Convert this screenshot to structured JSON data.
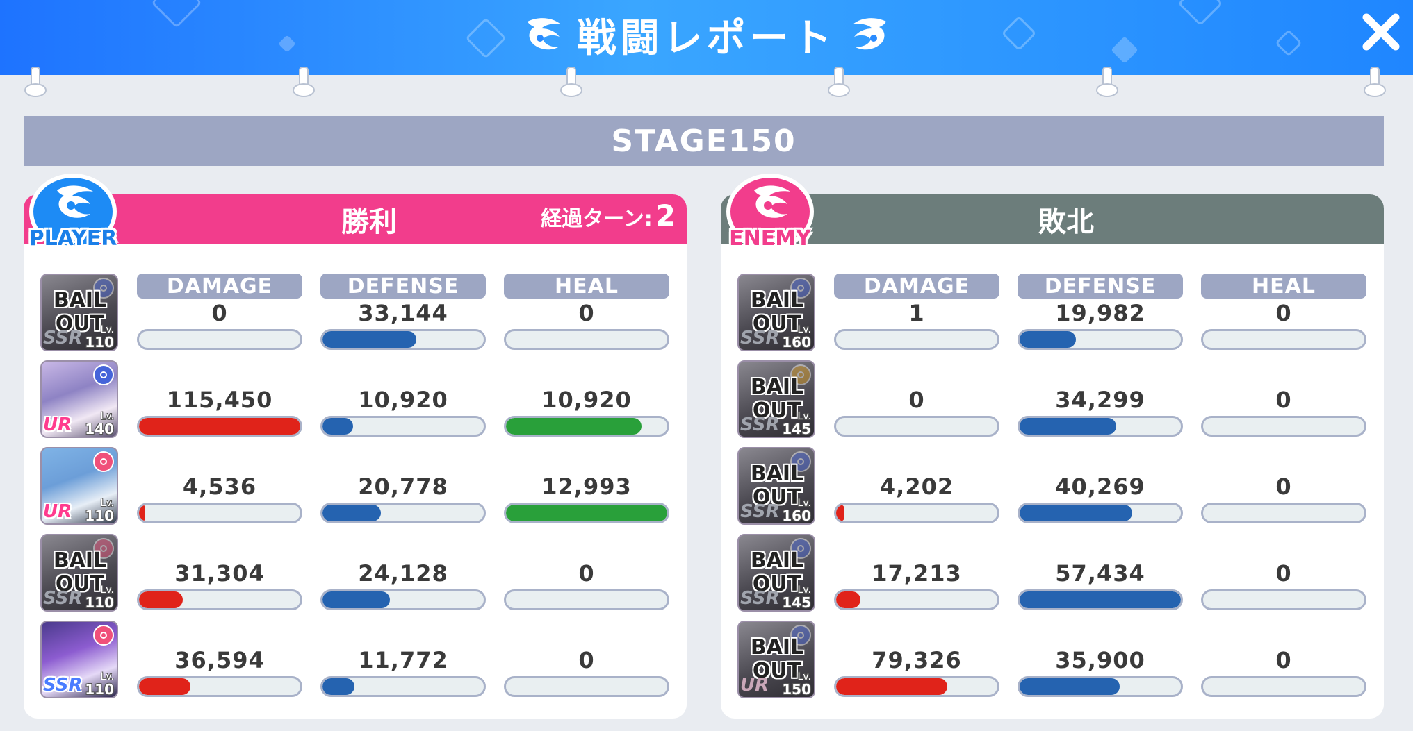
{
  "header": {
    "title": "戦闘レポート",
    "close_icon": "close-icon"
  },
  "stage": {
    "label": "STAGE150"
  },
  "columns": {
    "damage": "DAMAGE",
    "defense": "DEFENSE",
    "heal": "HEAL"
  },
  "player": {
    "badge": "PLAYER",
    "result": "勝利",
    "turns_label": "経過ターン:",
    "turns_value": "2",
    "units": [
      {
        "bail": true,
        "bail_line1": "BAIL",
        "bail_line2": "OUT",
        "rarity": "SSR",
        "lv_label": "Lv.",
        "level": "110",
        "damage": "0",
        "defense": "33,144",
        "heal": "0",
        "damage_ratio": 0,
        "defense_ratio": 0.58,
        "heal_ratio": 0
      },
      {
        "bail": false,
        "rarity": "UR",
        "lv_label": "Lv.",
        "level": "140",
        "damage": "115,450",
        "defense": "10,920",
        "heal": "10,920",
        "damage_ratio": 1.0,
        "defense_ratio": 0.19,
        "heal_ratio": 0.84
      },
      {
        "bail": false,
        "rarity": "UR",
        "lv_label": "Lv.",
        "level": "110",
        "damage": "4,536",
        "defense": "20,778",
        "heal": "12,993",
        "damage_ratio": 0.04,
        "defense_ratio": 0.36,
        "heal_ratio": 1.0
      },
      {
        "bail": true,
        "bail_line1": "BAIL",
        "bail_line2": "OUT",
        "rarity": "SSR",
        "lv_label": "Lv.",
        "level": "110",
        "damage": "31,304",
        "defense": "24,128",
        "heal": "0",
        "damage_ratio": 0.27,
        "defense_ratio": 0.42,
        "heal_ratio": 0
      },
      {
        "bail": false,
        "rarity": "SSR",
        "lv_label": "Lv.",
        "level": "110",
        "damage": "36,594",
        "defense": "11,772",
        "heal": "0",
        "damage_ratio": 0.32,
        "defense_ratio": 0.2,
        "heal_ratio": 0
      }
    ]
  },
  "enemy": {
    "badge": "ENEMY",
    "result": "敗北",
    "units": [
      {
        "bail": true,
        "bail_line1": "BAIL",
        "bail_line2": "OUT",
        "rarity": "SSR",
        "lv_label": "Lv.",
        "level": "160",
        "damage": "1",
        "defense": "19,982",
        "heal": "0",
        "damage_ratio": 0,
        "defense_ratio": 0.35,
        "heal_ratio": 0
      },
      {
        "bail": true,
        "bail_line1": "BAIL",
        "bail_line2": "OUT",
        "rarity": "SSR",
        "lv_label": "Lv.",
        "level": "145",
        "damage": "0",
        "defense": "34,299",
        "heal": "0",
        "damage_ratio": 0,
        "defense_ratio": 0.6,
        "heal_ratio": 0
      },
      {
        "bail": true,
        "bail_line1": "BAIL",
        "bail_line2": "OUT",
        "rarity": "SSR",
        "lv_label": "Lv.",
        "level": "160",
        "damage": "4,202",
        "defense": "40,269",
        "heal": "0",
        "damage_ratio": 0.05,
        "defense_ratio": 0.7,
        "heal_ratio": 0
      },
      {
        "bail": true,
        "bail_line1": "BAIL",
        "bail_line2": "OUT",
        "rarity": "SSR",
        "lv_label": "Lv.",
        "level": "145",
        "damage": "17,213",
        "defense": "57,434",
        "heal": "0",
        "damage_ratio": 0.15,
        "defense_ratio": 1.0,
        "heal_ratio": 0
      },
      {
        "bail": true,
        "bail_line1": "BAIL",
        "bail_line2": "OUT",
        "rarity": "UR",
        "lv_label": "Lv.",
        "level": "150",
        "damage": "79,326",
        "defense": "35,900",
        "heal": "0",
        "damage_ratio": 0.69,
        "defense_ratio": 0.62,
        "heal_ratio": 0
      }
    ]
  }
}
